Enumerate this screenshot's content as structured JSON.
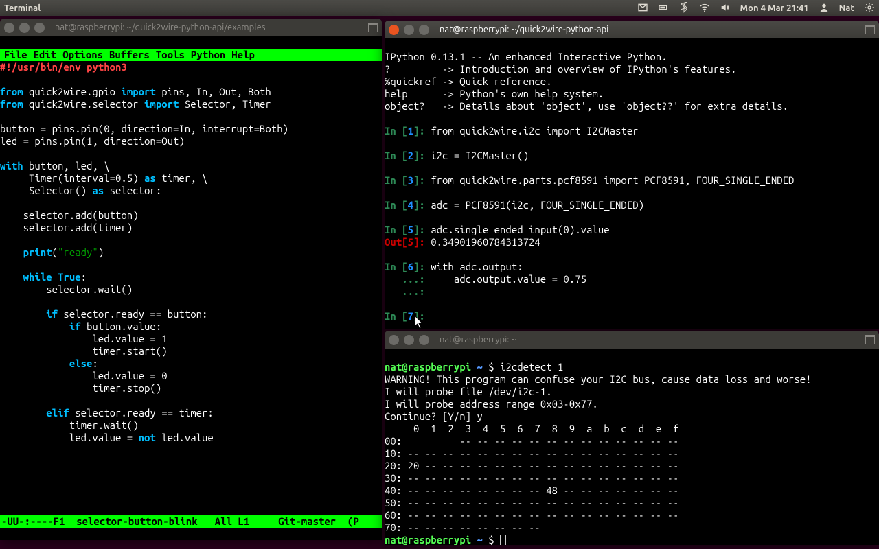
{
  "panel": {
    "app_title": "Terminal",
    "clock": "Mon 4 Mar 21:41",
    "user": "Nat"
  },
  "win_emacs": {
    "title": "nat@raspberrypi: ~/quick2wire-python-api/examples",
    "menu": [
      "File",
      "Edit",
      "Options",
      "Buffers",
      "Tools",
      "Python",
      "Help"
    ],
    "shebang": "#!/usr/bin/env python3",
    "modeline": "-UU-:----F1  selector-button-blink   All L1     Git-master  (P"
  },
  "win_ipy": {
    "title": "nat@raspberrypi: ~/quick2wire-python-api",
    "banner1": "IPython 0.13.1 -- An enhanced Interactive Python.",
    "banner2": "?         -> Introduction and overview of IPython's features.",
    "banner3": "%quickref -> Quick reference.",
    "banner4": "help      -> Python's own help system.",
    "banner5": "object?   -> Details about 'object', use 'object??' for extra details.",
    "in1": "from quick2wire.i2c import I2CMaster",
    "in2": "i2c = I2CMaster()",
    "in3": "from quick2wire.parts.pcf8591 import PCF8591, FOUR_SINGLE_ENDED",
    "in4": "adc = PCF8591(i2c, FOUR_SINGLE_ENDED)",
    "in5": "adc.single_ended_input(0).value",
    "out5": "0.34901960784313724",
    "in6a": "with adc.output:",
    "in6b": "    adc.output.value = 0.75",
    "in6c": ""
  },
  "win_sh": {
    "title": "nat@raspberrypi: ~",
    "prompt_user": "nat@raspberrypi",
    "prompt_path": "~",
    "cmd1": "i2cdetect 1",
    "l1": "WARNING! This program can confuse your I2C bus, cause data loss and worse!",
    "l2": "I will probe file /dev/i2c-1.",
    "l3": "I will probe address range 0x03-0x77.",
    "l4": "Continue? [Y/n] y",
    "hdr": "     0  1  2  3  4  5  6  7  8  9  a  b  c  d  e  f",
    "r00": "00:          -- -- -- -- -- -- -- -- -- -- -- -- --",
    "r10": "10: -- -- -- -- -- -- -- -- -- -- -- -- -- -- -- --",
    "r20": "20: 20 -- -- -- -- -- -- -- -- -- -- -- -- -- -- --",
    "r30": "30: -- -- -- -- -- -- -- -- -- -- -- -- -- -- -- --",
    "r40": "40: -- -- -- -- -- -- -- -- 48 -- -- -- -- -- -- --",
    "r50": "50: -- -- -- -- -- -- -- -- -- -- -- -- -- -- -- --",
    "r60": "60: -- -- -- -- -- -- -- -- -- -- -- -- -- -- -- --",
    "r70": "70: -- -- -- -- -- -- -- --"
  }
}
